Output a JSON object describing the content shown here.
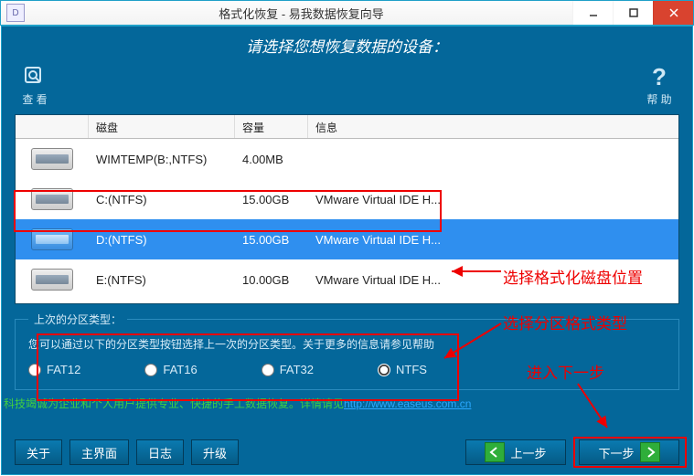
{
  "window": {
    "title": "格式化恢复 - 易我数据恢复向导",
    "app_initial": "D"
  },
  "header": {
    "prompt": "请选择您想恢复数据的设备："
  },
  "toolbar": {
    "left_label": "查 看",
    "right_label": "帮 助"
  },
  "columns": {
    "disk": "磁盘",
    "capacity": "容量",
    "info": "信息"
  },
  "disks": [
    {
      "name": "WIMTEMP(B:,NTFS)",
      "capacity": "4.00MB",
      "info": ""
    },
    {
      "name": "C:(NTFS)",
      "capacity": "15.00GB",
      "info": "VMware Virtual IDE H..."
    },
    {
      "name": "D:(NTFS)",
      "capacity": "15.00GB",
      "info": "VMware Virtual IDE H..."
    },
    {
      "name": "E:(NTFS)",
      "capacity": "10.00GB",
      "info": "VMware Virtual IDE H..."
    }
  ],
  "selected_disk_index": 2,
  "partition_group": {
    "legend": "上次的分区类型：",
    "hint": "您可以通过以下的分区类型按钮选择上一次的分区类型。关于更多的信息请参见帮助",
    "options": [
      "FAT12",
      "FAT16",
      "FAT32",
      "NTFS"
    ],
    "selected": "NTFS"
  },
  "footer_link": {
    "seg1": "科技竭诚为企业和个人用户提供专业、快捷的手工数据恢复。详情请见",
    "seg2": "http://www.easeus.com.cn"
  },
  "buttons": {
    "about": "关于",
    "main": "主界面",
    "log": "日志",
    "upgrade": "升级",
    "prev": "上一步",
    "next": "下一步"
  },
  "annotations": {
    "a1": "选择格式化磁盘位置",
    "a2": "选择分区格式类型",
    "a3": "进入下一步"
  }
}
